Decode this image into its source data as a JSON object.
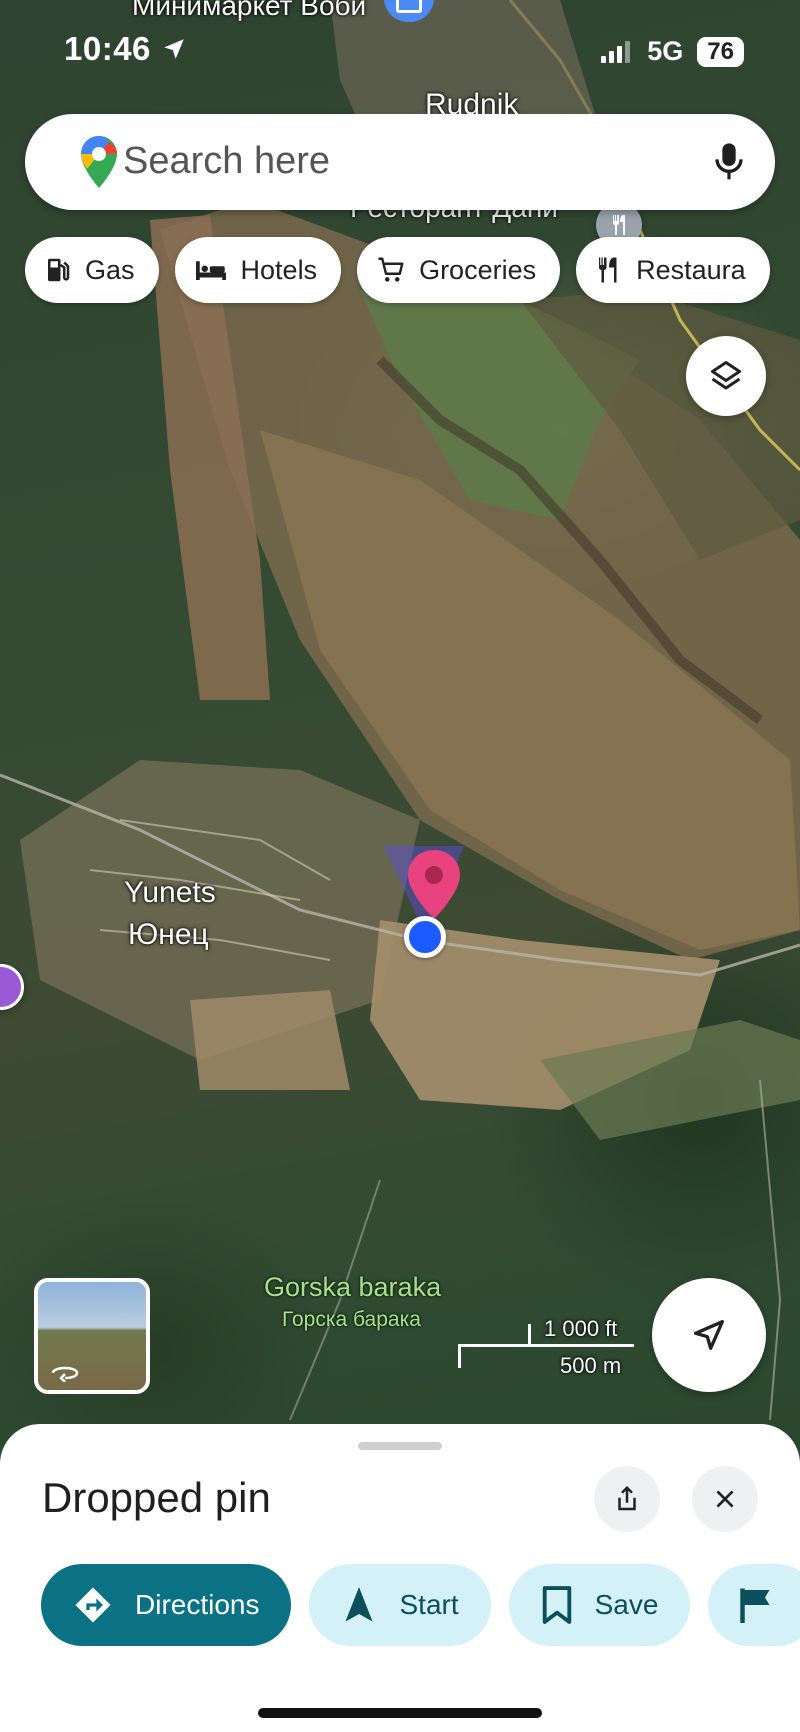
{
  "status_bar": {
    "time": "10:46",
    "network": "5G",
    "battery": "76"
  },
  "search": {
    "placeholder": "Search here"
  },
  "chips": [
    {
      "label": "Gas",
      "icon": "gas-station-icon"
    },
    {
      "label": "Hotels",
      "icon": "bed-icon"
    },
    {
      "label": "Groceries",
      "icon": "cart-icon"
    },
    {
      "label": "Restaura",
      "icon": "restaurant-icon"
    }
  ],
  "map_labels": {
    "top_store": "Минимаркет Вобй",
    "rudnik": "Rudnik",
    "restaurant": "Ресторант Дани",
    "yunets_latin": "Yunets",
    "yunets_cyrillic": "Юнец",
    "gorska_latin": "Gorska baraka",
    "gorska_cyrillic": "Горска барака"
  },
  "scale": {
    "imperial": "1 000 ft",
    "metric": "500 m"
  },
  "sheet": {
    "title": "Dropped pin",
    "actions": [
      {
        "label": "Directions"
      },
      {
        "label": "Start"
      },
      {
        "label": "Save"
      }
    ]
  },
  "colors": {
    "pin": "#e8437f",
    "location_dot": "#1a5cff",
    "primary": "#0b7285",
    "secondary_bg": "#d3f1f6"
  }
}
